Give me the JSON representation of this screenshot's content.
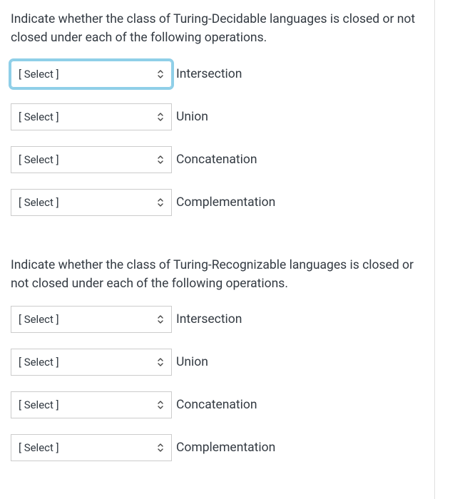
{
  "sections": [
    {
      "prompt": "Indicate whether the class of Turing-Decidable languages is closed or not closed under each of the following operations.",
      "rows": [
        {
          "select_value": "[ Select ]",
          "label": "Intersection",
          "focused": true
        },
        {
          "select_value": "[ Select ]",
          "label": "Union",
          "focused": false
        },
        {
          "select_value": "[ Select ]",
          "label": "Concatenation",
          "focused": false
        },
        {
          "select_value": "[ Select ]",
          "label": "Complementation",
          "focused": false
        }
      ]
    },
    {
      "prompt": "Indicate whether the class of Turing-Recognizable languages is closed or not closed under each of the following operations.",
      "rows": [
        {
          "select_value": "[ Select ]",
          "label": "Intersection",
          "focused": false
        },
        {
          "select_value": "[ Select ]",
          "label": "Union",
          "focused": false
        },
        {
          "select_value": "[ Select ]",
          "label": "Concatenation",
          "focused": false
        },
        {
          "select_value": "[ Select ]",
          "label": "Complementation",
          "focused": false
        }
      ]
    }
  ]
}
